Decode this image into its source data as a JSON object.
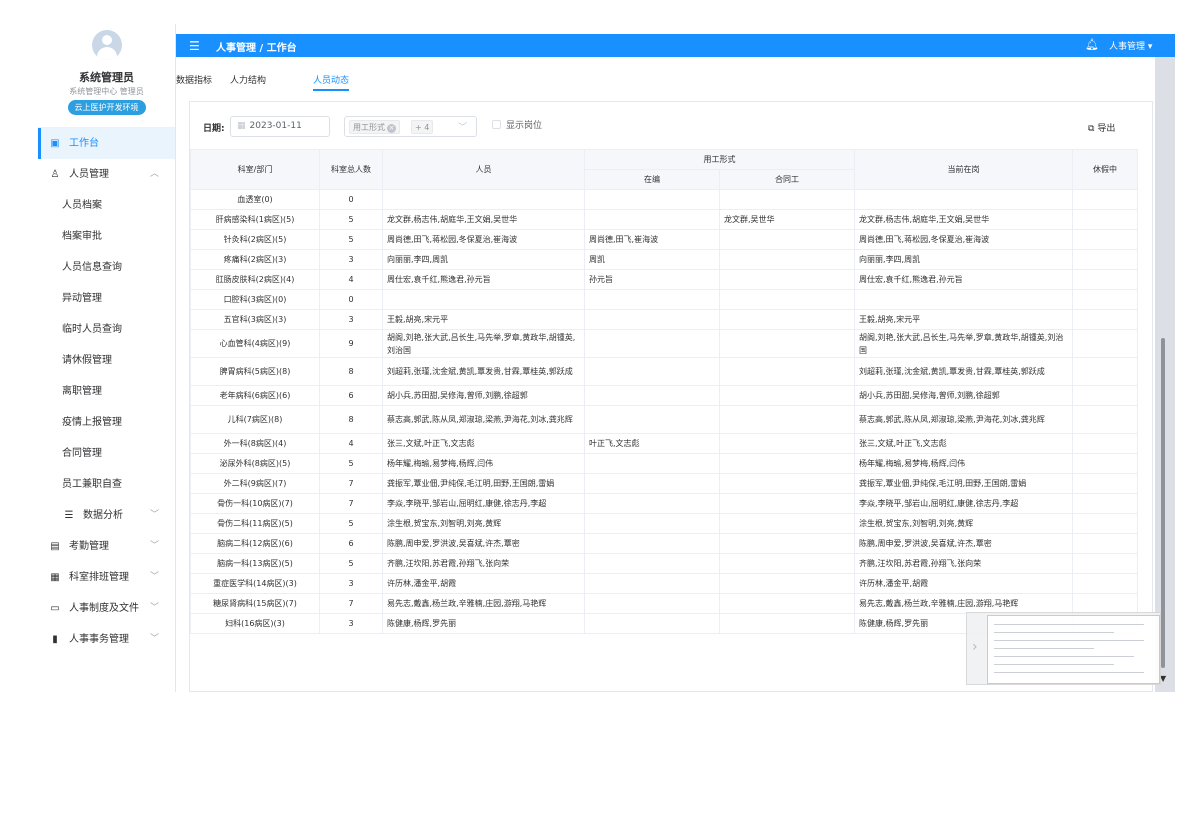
{
  "profile": {
    "name": "系统管理员",
    "subtitle": "系统管理中心 管理员",
    "env": "云上医护开发环境"
  },
  "sidebar": {
    "items": [
      {
        "label": "工作台",
        "icon": "dashboard-icon",
        "active": true
      },
      {
        "label": "人员管理",
        "icon": "people-icon"
      },
      {
        "label": "人员档案"
      },
      {
        "label": "档案审批"
      },
      {
        "label": "人员信息查询"
      },
      {
        "label": "异动管理"
      },
      {
        "label": "临时人员查询"
      },
      {
        "label": "请休假管理"
      },
      {
        "label": "离职管理"
      },
      {
        "label": "疫情上报管理"
      },
      {
        "label": "合同管理"
      },
      {
        "label": "员工兼职自查"
      },
      {
        "label": "数据分析",
        "icon": "chart-icon"
      },
      {
        "label": "考勤管理",
        "icon": "calendar-icon"
      },
      {
        "label": "科室排班管理",
        "icon": "schedule-icon"
      },
      {
        "label": "人事制度及文件",
        "icon": "folder-icon"
      },
      {
        "label": "人事事务管理",
        "icon": "document-icon"
      }
    ]
  },
  "header": {
    "breadcrumb": "人事管理 / 工作台",
    "user": "人事管理 ▾"
  },
  "tabs": [
    "数据指标",
    "人力结构",
    "人员动态"
  ],
  "filter": {
    "date_label": "日期:",
    "date_value": "2023-01-11",
    "tag_label": "用工形式",
    "tag_more": "+ 4",
    "checkbox_label": "显示岗位",
    "export_label": "导出"
  },
  "table": {
    "headers": {
      "dept": "科室/部门",
      "total": "科室总人数",
      "people": "人员",
      "employ": "用工形式",
      "onpost": "在编",
      "contract": "合同工",
      "current": "当前在岗",
      "leave": "休假中"
    },
    "rows": [
      {
        "dept": "血透室(0)",
        "total": "0",
        "people": "",
        "onpost": "",
        "contract": "",
        "current": ""
      },
      {
        "dept": "肝病感染科(1病区)(5)",
        "total": "5",
        "people": "龙文群,杨志伟,胡庭华,王文娟,吴世华",
        "onpost": "",
        "contract": "龙文群,吴世华",
        "current": "龙文群,杨志伟,胡庭华,王文娟,吴世华"
      },
      {
        "dept": "针灸科(2病区)(5)",
        "total": "5",
        "people": "周尚德,田飞,蒋松园,冬保夏治,崔海波",
        "onpost": "周尚德,田飞,崔海波",
        "contract": "",
        "current": "周尚德,田飞,蒋松园,冬保夏治,崔海波"
      },
      {
        "dept": "疼痛科(2病区)(3)",
        "total": "3",
        "people": "向丽丽,李四,周凯",
        "onpost": "周凯",
        "contract": "",
        "current": "向丽丽,李四,周凯"
      },
      {
        "dept": "肛肠皮肤科(2病区)(4)",
        "total": "4",
        "people": "周仕宏,袁千红,熊逸君,孙元旨",
        "onpost": "孙元旨",
        "contract": "",
        "current": "周仕宏,袁千红,熊逸君,孙元旨"
      },
      {
        "dept": "口腔科(3病区)(0)",
        "total": "0",
        "people": "",
        "onpost": "",
        "contract": "",
        "current": ""
      },
      {
        "dept": "五官科(3病区)(3)",
        "total": "3",
        "people": "王毅,胡亮,宋元平",
        "onpost": "",
        "contract": "",
        "current": "王毅,胡亮,宋元平"
      },
      {
        "dept": "心血管科(4病区)(9)",
        "total": "9",
        "people": "胡阁,刘艳,张大武,吕长生,马先举,罗章,黄政华,胡锺英,刘治国",
        "onpost": "",
        "contract": "",
        "current": "胡阁,刘艳,张大武,吕长生,马先举,罗章,黄政华,胡锺英,刘治国",
        "tall": true
      },
      {
        "dept": "脾胃病科(5病区)(8)",
        "total": "8",
        "people": "刘超莉,张瑾,沈金斌,黄凯,覃发贵,甘霖,覃桂英,郭跃成",
        "onpost": "",
        "contract": "",
        "current": "刘超莉,张瑾,沈金斌,黄凯,覃发贵,甘霖,覃桂英,郭跃成",
        "tall": true
      },
      {
        "dept": "老年病科(6病区)(6)",
        "total": "6",
        "people": "胡小兵,苏田甜,吴修海,曾师,刘鹏,徐超郭",
        "onpost": "",
        "contract": "",
        "current": "胡小兵,苏田甜,吴修海,曾师,刘鹏,徐超郭"
      },
      {
        "dept": "儿科(7病区)(8)",
        "total": "8",
        "people": "蔡志高,郭武,陈从凤,郑淑琼,梁燕,尹海花,刘冰,龚兆辉",
        "onpost": "",
        "contract": "",
        "current": "蔡志高,郭武,陈从凤,郑淑琼,梁燕,尹海花,刘冰,龚兆辉",
        "tall": true
      },
      {
        "dept": "外一科(8病区)(4)",
        "total": "4",
        "people": "张三,文斌,叶正飞,文志彪",
        "onpost": "叶正飞,文志彪",
        "contract": "",
        "current": "张三,文斌,叶正飞,文志彪"
      },
      {
        "dept": "泌尿外科(8病区)(5)",
        "total": "5",
        "people": "杨年耀,梅瑜,易梦梅,杨辉,闫伟",
        "onpost": "",
        "contract": "",
        "current": "杨年耀,梅瑜,易梦梅,杨辉,闫伟"
      },
      {
        "dept": "外二科(9病区)(7)",
        "total": "7",
        "people": "龚振军,覃业佃,尹纯保,毛江明,田野,王国朗,雷娟",
        "onpost": "",
        "contract": "",
        "current": "龚振军,覃业佃,尹纯保,毛江明,田野,王国朗,雷娟"
      },
      {
        "dept": "骨伤一科(10病区)(7)",
        "total": "7",
        "people": "李焱,李晓平,邹岩山,屈明红,康健,徐志丹,李超",
        "onpost": "",
        "contract": "",
        "current": "李焱,李晓平,邹岩山,屈明红,康健,徐志丹,李超"
      },
      {
        "dept": "骨伤二科(11病区)(5)",
        "total": "5",
        "people": "涂生根,贺宝东,刘智明,刘亮,黄辉",
        "onpost": "",
        "contract": "",
        "current": "涂生根,贺宝东,刘智明,刘亮,黄辉"
      },
      {
        "dept": "脑病二科(12病区)(6)",
        "total": "6",
        "people": "陈鹏,周申爱,罗洪波,吴喜斌,许杰,覃密",
        "onpost": "",
        "contract": "",
        "current": "陈鹏,周申爱,罗洪波,吴喜斌,许杰,覃密"
      },
      {
        "dept": "脑病一科(13病区)(5)",
        "total": "5",
        "people": "齐鹏,汪坎阳,苏君霞,孙翔飞,张向荣",
        "onpost": "",
        "contract": "",
        "current": "齐鹏,汪坎阳,苏君霞,孙翔飞,张向荣"
      },
      {
        "dept": "重症医学科(14病区)(3)",
        "total": "3",
        "people": "许历林,潘金平,胡霞",
        "onpost": "",
        "contract": "",
        "current": "许历林,潘金平,胡霞"
      },
      {
        "dept": "糖尿肾病科(15病区)(7)",
        "total": "7",
        "people": "易先志,戴鑫,杨兰政,辛雅楠,庄园,游翔,马艳辉",
        "onpost": "",
        "contract": "",
        "current": "易先志,戴鑫,杨兰政,辛雅楠,庄园,游翔,马艳辉"
      },
      {
        "dept": "妇科(16病区)(3)",
        "total": "3",
        "people": "陈健康,杨辉,罗先丽",
        "onpost": "",
        "contract": "",
        "current": "陈健康,杨辉,罗先丽"
      }
    ]
  },
  "colors": {
    "primary": "#1890ff",
    "env_badge": "#2d9fe0",
    "header_bg": "#f5f7fa"
  }
}
